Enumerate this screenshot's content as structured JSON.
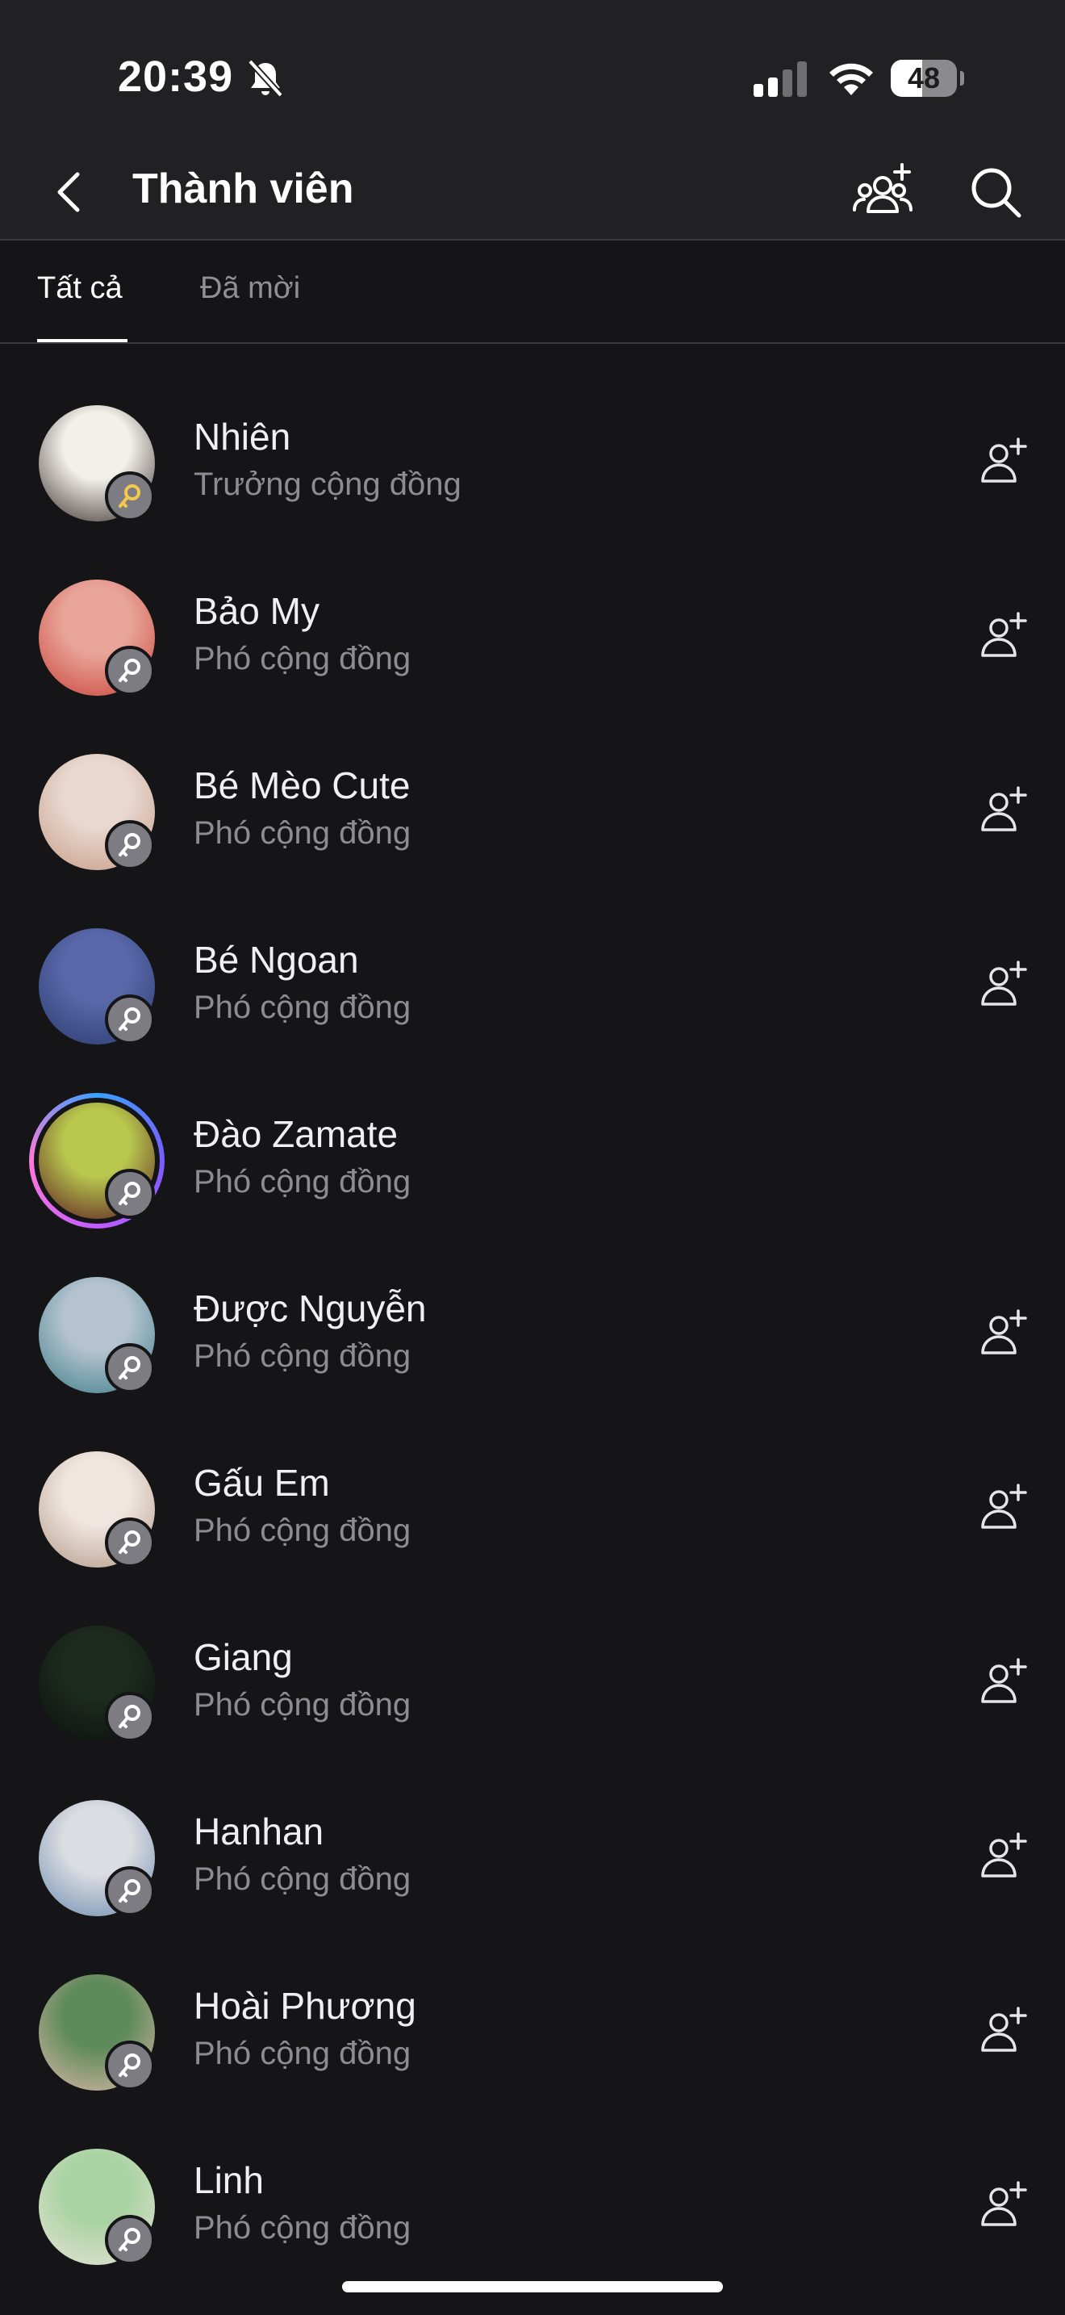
{
  "status_bar": {
    "time": "20:39",
    "battery_level": "48",
    "battery_fraction": 0.48,
    "icons": [
      "bell-muted-icon",
      "cellular-signal-icon",
      "wifi-icon",
      "battery-icon"
    ]
  },
  "header": {
    "title": "Thành viên",
    "back_icon": "chevron-left-icon",
    "add_members_icon": "add-group-icon",
    "search_icon": "search-icon"
  },
  "tabs": [
    {
      "label": "Tất cả",
      "active": true
    },
    {
      "label": "Đã mời",
      "active": false
    }
  ],
  "members": [
    {
      "name": "Nhiên",
      "role": "Trưởng cộng đồng",
      "key_color": "#f2c94c",
      "avatar_colors": [
        "#f3efe9",
        "#3a3230"
      ],
      "has_story_ring": false,
      "show_add_friend": true
    },
    {
      "name": "Bảo My",
      "role": "Phó cộng đồng",
      "key_color": "#ffffff",
      "avatar_colors": [
        "#e9a59a",
        "#c9443a"
      ],
      "has_story_ring": false,
      "show_add_friend": true
    },
    {
      "name": "Bé Mèo Cute",
      "role": "Phó cộng đồng",
      "key_color": "#ffffff",
      "avatar_colors": [
        "#e8d8cf",
        "#c79c86"
      ],
      "has_story_ring": false,
      "show_add_friend": true
    },
    {
      "name": "Bé Ngoan",
      "role": "Phó cộng đồng",
      "key_color": "#ffffff",
      "avatar_colors": [
        "#5868a8",
        "#2b3a6e"
      ],
      "has_story_ring": false,
      "show_add_friend": true
    },
    {
      "name": "Đào Zamate",
      "role": "Phó cộng đồng",
      "key_color": "#ffffff",
      "avatar_colors": [
        "#b8c74e",
        "#5a1a22"
      ],
      "has_story_ring": true,
      "show_add_friend": false
    },
    {
      "name": "Được Nguyễn",
      "role": "Phó cộng đồng",
      "key_color": "#ffffff",
      "avatar_colors": [
        "#b4c3cf",
        "#3e7e8a"
      ],
      "has_story_ring": false,
      "show_add_friend": true
    },
    {
      "name": "Gấu Em",
      "role": "Phó cộng đồng",
      "key_color": "#ffffff",
      "avatar_colors": [
        "#efe6e0",
        "#b59a88"
      ],
      "has_story_ring": false,
      "show_add_friend": true
    },
    {
      "name": "Giang",
      "role": "Phó cộng đồng",
      "key_color": "#ffffff",
      "avatar_colors": [
        "#1d2a1f",
        "#0b0f0c"
      ],
      "has_story_ring": false,
      "show_add_friend": true
    },
    {
      "name": "Hanhan",
      "role": "Phó cộng đồng",
      "key_color": "#ffffff",
      "avatar_colors": [
        "#dcdde2",
        "#6c8cb0"
      ],
      "has_story_ring": false,
      "show_add_friend": true
    },
    {
      "name": "Hoài Phương",
      "role": "Phó cộng đồng",
      "key_color": "#ffffff",
      "avatar_colors": [
        "#5f8a5a",
        "#d9b8a8"
      ],
      "has_story_ring": false,
      "show_add_friend": true
    },
    {
      "name": "Linh",
      "role": "Phó cộng đồng",
      "key_color": "#ffffff",
      "avatar_colors": [
        "#a9d3a2",
        "#e9e2d8"
      ],
      "has_story_ring": false,
      "show_add_friend": true
    }
  ],
  "colors": {
    "background": "#151517",
    "header_background": "#212124",
    "primary_text": "#f0f0f2",
    "secondary_text": "#8c8c92",
    "badge": "#7c7c82"
  }
}
